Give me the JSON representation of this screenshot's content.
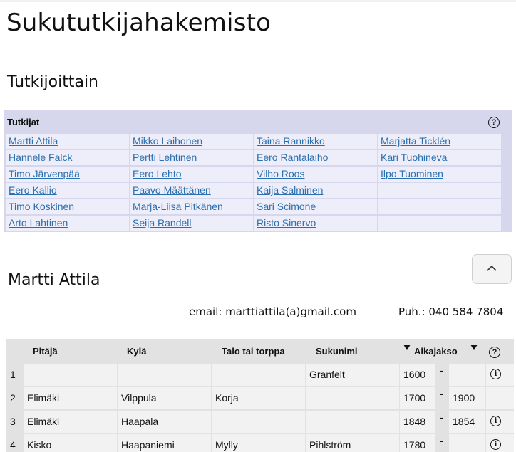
{
  "page": {
    "title": "Sukututkijahakemisto",
    "section_title": "Tutkijoittain"
  },
  "researchers": {
    "header": "Tutkijat",
    "help_symbol": "?",
    "columns": [
      [
        "Martti Attila",
        "Hannele Falck",
        "Timo Järvenpää",
        "Eero Kallio",
        "Timo Koskinen",
        "Arto Lahtinen"
      ],
      [
        "Mikko Laihonen",
        "Pertti Lehtinen",
        "Eero Lehto",
        "Paavo Määttänen",
        "Marja-Liisa Pitkänen",
        "Seija Randell"
      ],
      [
        "Taina Rannikko",
        "Eero Rantalaiho",
        "Vilho Roos",
        "Kaija Salminen",
        "Sari Scimone",
        "Risto Sinervo"
      ],
      [
        "Marjatta Ticklén",
        "Kari Tuohineva",
        "Ilpo Tuominen",
        "",
        "",
        ""
      ]
    ]
  },
  "researcher": {
    "name": "Martti Attila",
    "email": "email: marttiattila(a)gmail.com",
    "phone": "Puh.: 040 584 7804"
  },
  "locations": {
    "headers": {
      "parish": "Pitäjä",
      "village": "Kylä",
      "house": "Talo tai torppa",
      "surname": "Sukunimi",
      "period": "Aikajakso",
      "help": "?"
    },
    "rows": [
      {
        "num": "1",
        "parish": "",
        "village": "",
        "house": "",
        "surname": "Granfelt",
        "start": "1600",
        "dash": "-",
        "end": "",
        "info": "i"
      },
      {
        "num": "2",
        "parish": "Elimäki",
        "village": "Vilppula",
        "house": "Korja",
        "surname": "",
        "start": "1700",
        "dash": "-",
        "end": "1900",
        "info": ""
      },
      {
        "num": "3",
        "parish": "Elimäki",
        "village": "Haapala",
        "house": "",
        "surname": "",
        "start": "1848",
        "dash": "-",
        "end": "1854",
        "info": "i"
      },
      {
        "num": "4",
        "parish": "Kisko",
        "village": "Haapaniemi",
        "house": "Mylly",
        "surname": "Pihlström",
        "start": "1780",
        "dash": "-",
        "end": "",
        "info": "i"
      }
    ]
  }
}
